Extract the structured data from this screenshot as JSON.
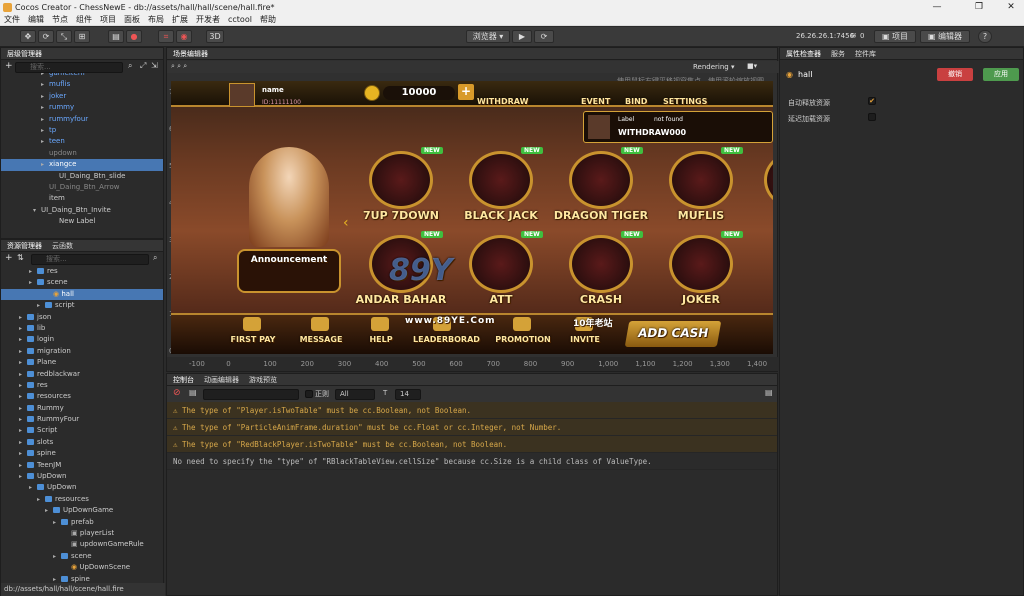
{
  "window": {
    "title": "Cocos Creator - ChessNewE - db://assets/hall/hall/scene/hall.fire*"
  },
  "menu": [
    "文件",
    "编辑",
    "节点",
    "组件",
    "项目",
    "面板",
    "布局",
    "扩展",
    "开发者",
    "cctool",
    "帮助"
  ],
  "toolbar": {
    "mode3d": "3D",
    "browser": "浏览器 ▾",
    "ip": "26.26.26.1:7456",
    "signal": "0",
    "project": "项目",
    "editor": "编辑器",
    "help": "?"
  },
  "hierarchy": {
    "tab": "层级管理器",
    "search_placeholder": "搜索...",
    "items": [
      {
        "label": "gameitem",
        "style": "blue",
        "indent": 40
      },
      {
        "label": "muflis",
        "style": "blue",
        "indent": 40
      },
      {
        "label": "joker",
        "style": "blue",
        "indent": 40
      },
      {
        "label": "rummy",
        "style": "blue",
        "indent": 40
      },
      {
        "label": "rummyfour",
        "style": "blue",
        "indent": 40
      },
      {
        "label": "tp",
        "style": "blue",
        "indent": 40
      },
      {
        "label": "teen",
        "style": "blue",
        "indent": 40
      },
      {
        "label": "updown",
        "style": "grey",
        "indent": 40
      },
      {
        "label": "xiangce",
        "style": "sel",
        "indent": 40
      },
      {
        "label": "UI_Daing_Btn_slide",
        "style": "",
        "indent": 50
      },
      {
        "label": "UI_Daing_Btn_Arrow",
        "style": "grey",
        "indent": 40
      },
      {
        "label": "item",
        "style": "",
        "indent": 40
      },
      {
        "label": "UI_Daing_Btn_Invite",
        "style": "",
        "indent": 32
      },
      {
        "label": "New Label",
        "style": "",
        "indent": 50
      }
    ]
  },
  "assets": {
    "tab": "资源管理器",
    "tab2": "云函数",
    "search_placeholder": "搜索...",
    "items": [
      {
        "label": "res",
        "indent": 36,
        "type": "folder"
      },
      {
        "label": "scene",
        "indent": 36,
        "type": "folder"
      },
      {
        "label": "hall",
        "indent": 52,
        "type": "scene",
        "sel": true
      },
      {
        "label": "script",
        "indent": 44,
        "type": "folder"
      },
      {
        "label": "json",
        "indent": 26,
        "type": "folder"
      },
      {
        "label": "lib",
        "indent": 26,
        "type": "folder"
      },
      {
        "label": "login",
        "indent": 26,
        "type": "folder"
      },
      {
        "label": "migration",
        "indent": 26,
        "type": "folder"
      },
      {
        "label": "Plane",
        "indent": 26,
        "type": "folder"
      },
      {
        "label": "redblackwar",
        "indent": 26,
        "type": "folder"
      },
      {
        "label": "res",
        "indent": 26,
        "type": "folder"
      },
      {
        "label": "resources",
        "indent": 26,
        "type": "folder"
      },
      {
        "label": "Rummy",
        "indent": 26,
        "type": "folder"
      },
      {
        "label": "RummyFour",
        "indent": 26,
        "type": "folder"
      },
      {
        "label": "Script",
        "indent": 26,
        "type": "folder"
      },
      {
        "label": "slots",
        "indent": 26,
        "type": "folder"
      },
      {
        "label": "spine",
        "indent": 26,
        "type": "folder"
      },
      {
        "label": "TeenJM",
        "indent": 26,
        "type": "folder"
      },
      {
        "label": "UpDown",
        "indent": 26,
        "type": "folder"
      },
      {
        "label": "UpDown",
        "indent": 36,
        "type": "folder"
      },
      {
        "label": "resources",
        "indent": 44,
        "type": "folder"
      },
      {
        "label": "UpDownGame",
        "indent": 52,
        "type": "folder"
      },
      {
        "label": "prefab",
        "indent": 60,
        "type": "folder"
      },
      {
        "label": "playerList",
        "indent": 70,
        "type": "file"
      },
      {
        "label": "updownGameRule",
        "indent": 70,
        "type": "file"
      },
      {
        "label": "scene",
        "indent": 60,
        "type": "folder"
      },
      {
        "label": "UpDownScene",
        "indent": 70,
        "type": "scene"
      },
      {
        "label": "spine",
        "indent": 60,
        "type": "folder"
      }
    ],
    "status": "db://assets/hall/hall/scene/hall.fire"
  },
  "scene": {
    "tab": "场景编辑器",
    "hint": "使用鼠标右键平移视窗焦点，使用滚轮缩放视图",
    "rendering": "Rendering ▾",
    "vruler": [
      "700",
      "600",
      "500",
      "400",
      "300",
      "200",
      "100",
      "0"
    ],
    "hruler": [
      "-100",
      "0",
      "100",
      "200",
      "300",
      "400",
      "500",
      "600",
      "700",
      "800",
      "900",
      "1,000",
      "1,100",
      "1,200",
      "1,300",
      "1,400"
    ],
    "game": {
      "name": "name",
      "id": "ID:11111100",
      "coins": "10000",
      "withdraw": "WITHDRAW",
      "event": "EVENT",
      "bind": "BIND",
      "settings": "SETTINGS",
      "label": "Label",
      "notfound": "not found",
      "withdraw_msg": "WITHDRAW000",
      "new": "NEW",
      "games": [
        "7UP 7DOWN",
        "BLACK JACK",
        "DRAGON TIGER",
        "MUFLIS",
        "ANDAR BAHAR",
        "ATT",
        "CRASH",
        "JOKER",
        "RU"
      ],
      "announcement": "Announcement",
      "bottom": [
        "FIRST PAY",
        "MESSAGE",
        "HELP",
        "LEADERBORAD",
        "PROMOTION",
        "INVITE"
      ],
      "addcash": "ADD CASH",
      "watermark1": "89Y",
      "watermark2": "www.89YE.Com",
      "watermark3": "10年老站"
    }
  },
  "console": {
    "tabs": [
      "控制台",
      "动画编辑器",
      "游戏预览"
    ],
    "regex": "正则",
    "level": "All",
    "fontsize": "14",
    "lines": [
      {
        "type": "warn",
        "text": "The type of \"Player.isTwoTable\" must be cc.Boolean, not Boolean."
      },
      {
        "type": "warn",
        "text": "The type of \"ParticleAnimFrame.duration\" must be cc.Float or cc.Integer, not Number."
      },
      {
        "type": "warn",
        "text": "The type of \"RedBlackPlayer.isTwoTable\" must be cc.Boolean, not Boolean."
      },
      {
        "type": "info",
        "text": "No need to specify the \"type\" of \"RBlackTableView.cellSize\" because cc.Size is a child class of ValueType."
      }
    ]
  },
  "inspector": {
    "tabs": [
      "属性检查器",
      "服务",
      "控件库"
    ],
    "node": "hall",
    "revert": "撤销",
    "apply": "应用",
    "auto_release": "自动释放资源",
    "lazy_load": "延迟加载资源"
  },
  "colors": {
    "accent": "#4777b3",
    "warn": "#d7a84a",
    "revert": "#c94040",
    "apply": "#4e9a4e"
  }
}
